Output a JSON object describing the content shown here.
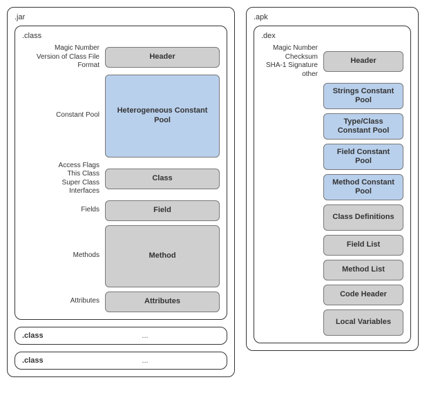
{
  "jar": {
    "title": ".jar",
    "class_box": {
      "title": ".class",
      "rows": [
        {
          "label": "Magic Number\nVersion of Class File Format",
          "block": "Header",
          "color": "grey",
          "size": "h-sm"
        },
        {
          "label": "Constant Pool",
          "block": "Heterogeneous\nConstant Pool",
          "color": "blue",
          "size": "h-lg"
        },
        {
          "label": "Access Flags\nThis Class\nSuper Class\nInterfaces",
          "block": "Class",
          "color": "grey",
          "size": "h-sm"
        },
        {
          "label": "Fields",
          "block": "Field",
          "color": "grey",
          "size": "h-sm"
        },
        {
          "label": "Methods",
          "block": "Method",
          "color": "grey",
          "size": "h-md"
        },
        {
          "label": "Attributes",
          "block": "Attributes",
          "color": "grey",
          "size": "h-sm"
        }
      ]
    },
    "stubs": [
      {
        "title": ".class",
        "dots": "..."
      },
      {
        "title": ".class",
        "dots": "..."
      }
    ]
  },
  "apk": {
    "title": ".apk",
    "dex_box": {
      "title": ".dex",
      "rows": [
        {
          "label": "Magic Number\nChecksum\nSHA-1 Signature\nother",
          "block": "Header",
          "color": "grey"
        },
        {
          "label": "",
          "block": "Strings\nConstant Pool",
          "color": "blue"
        },
        {
          "label": "",
          "block": "Type/Class\nConstant Pool",
          "color": "blue"
        },
        {
          "label": "",
          "block": "Field\nConstant Pool",
          "color": "blue"
        },
        {
          "label": "",
          "block": "Method\nConstant Pool",
          "color": "blue"
        },
        {
          "label": "",
          "block": "Class\nDefinitions",
          "color": "grey"
        },
        {
          "label": "",
          "block": "Field List",
          "color": "grey"
        },
        {
          "label": "",
          "block": "Method List",
          "color": "grey"
        },
        {
          "label": "",
          "block": "Code Header",
          "color": "grey"
        },
        {
          "label": "",
          "block": "Local\nVariables",
          "color": "grey"
        }
      ]
    }
  }
}
